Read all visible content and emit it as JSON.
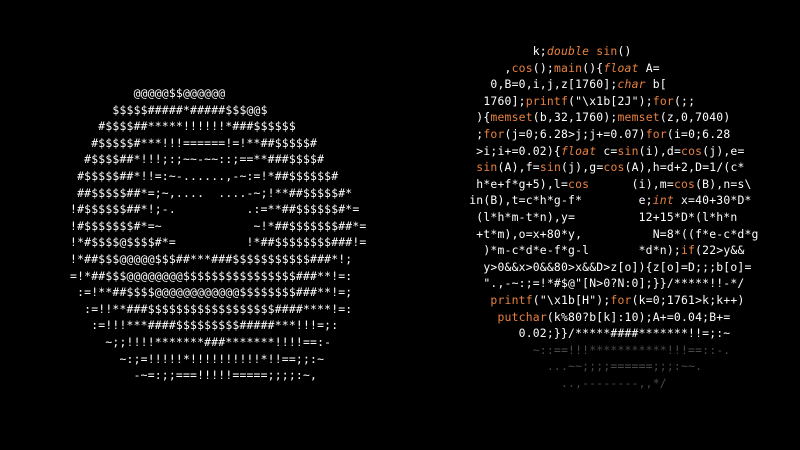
{
  "left_panel": {
    "ascii_lines": [
      "          @@@@@$$@@@@@@",
      "       $$$$$#####*#####$$$@@$",
      "     #$$$$##*****!!!!!!*###$$$$$$",
      "    #$$$$$#***!!!======!=!**##$$$$$#",
      "   #$$$$##*!!!;:;~~-~~::;==**###$$$$#",
      "  #$$$$$##*!!=:~-......,-~:=!*##$$$$$$#",
      "  ##$$$$$##*=;~,....  ....-~;!**##$$$$$#*",
      " !#$$$$$$##*!;-.          .:=**##$$$$$$#*=",
      " !#$$$$$$$#*=~             ~!*##$$$$$$$##*=",
      " !*#$$$$@$$$$#*=          !*##$$$$$$$$###!=",
      " !*##$$$@@@@@$$$##***###$$$$$$$$$$$###*!;",
      " =!*##$$$@@@@@@@@$$$$$$$$$$$$$$$$###**!=:",
      "  :=!**##$$$$@@@@@@@@@@@@$$$$$$$$###**!=;",
      "   :=!!**###$$$$$$$$$$$$$$$$$$####****!=:",
      "    :=!!!***####$$$$$$$$$#####***!!!=;:",
      "      ~;;!!!!*******###*******!!!!==:-",
      "        ~:;=!!!!!*!!!!!!!!!!*!!==;;:~",
      "          -~=:;;===!!!!!=====;;;;:~,"
    ]
  },
  "right_panel": {
    "code_lines": [
      "             k;double sin()",
      "         ,cos();main(){float A=",
      "       0,B=0,i,j,z[1760];char b[",
      "      1760];printf(\"\\x1b[2J\");for(;;",
      "     ){memset(b,32,1760);memset(z,0,7040)",
      "     ;for(j=0;6.28>j;j+=0.07)for(i=0;6.28",
      "     >i;i+=0.02){float c=sin(i),d=cos(j),e=",
      "     sin(A),f=sin(j),g=cos(A),h=d+2,D=1/(c*",
      "     h*e+f*g+5),l=cos      (i),m=cos(B),n=s\\",
      "    in(B),t=c*h*g-f*        e;int x=40+30*D*",
      "     (l*h*m-t*n),y=         12+15*D*(l*h*n",
      "     +t*m),o=x+80*y,          N=8*((f*e-c*d*g",
      "      )*m-c*d*e-f*g-l       *d*n);if(22>y&&",
      "      y>0&&x>0&&80>x&&D>z[o]){z[o]=D;;;b[o]=",
      "      \".,-~:;=!*#$@\"[N>0?N:0];}}/*****!!-*/",
      "       printf(\"\\x1b[H\");for(k=0;1761>k;k++)",
      "        putchar(k%80?b[k]:10);A+=0.04;B+=",
      "           0.02;}}/*****####*******!!=;:~",
      "             ~::==!!!***********!!!==::-.",
      "               ...~~;;;;======;;;:~~.",
      "                 ..,--------,,*/"
    ]
  },
  "colors": {
    "background": "#000000",
    "text": "#ffffff",
    "keyword": "#e8813f",
    "faded": "#4a4a4a"
  }
}
